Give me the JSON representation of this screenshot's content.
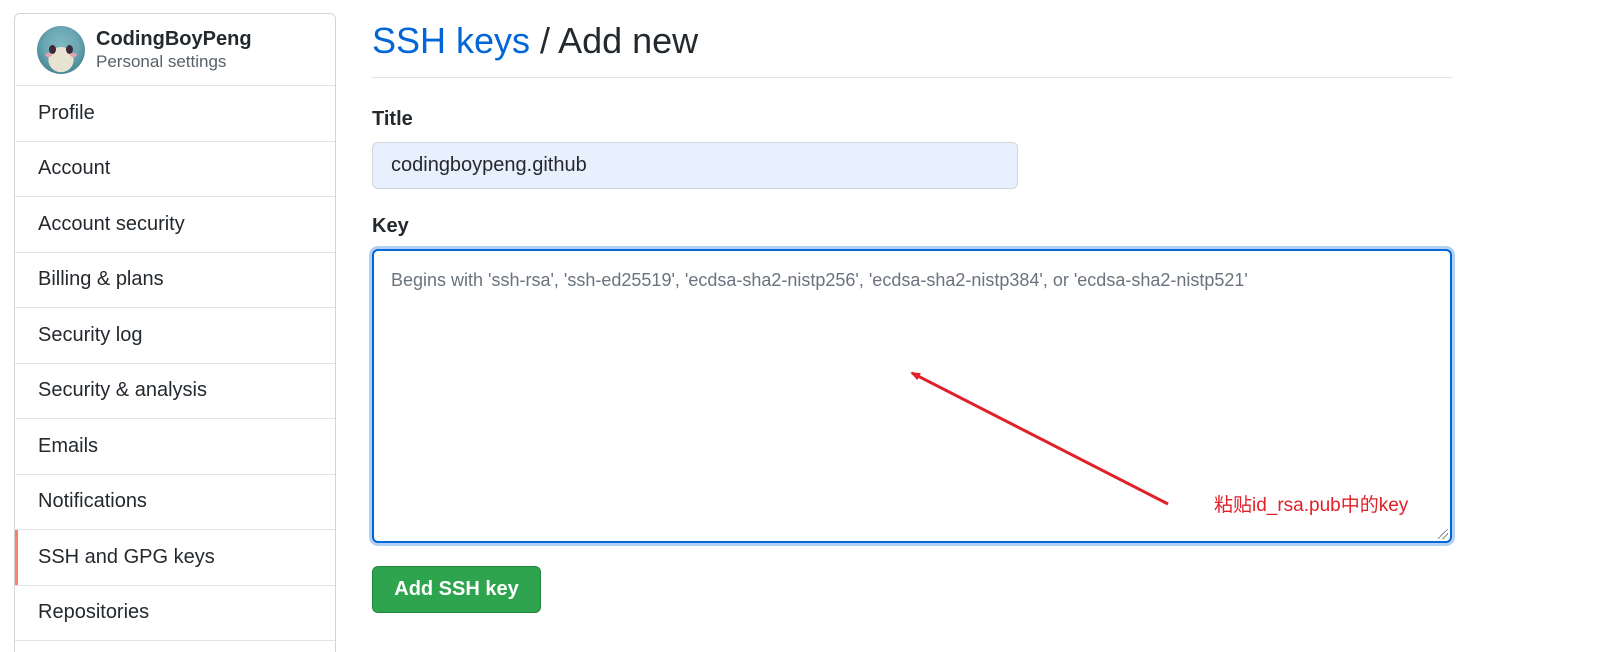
{
  "sidebar": {
    "user": {
      "name": "CodingBoyPeng",
      "subtitle": "Personal settings"
    },
    "items": [
      {
        "label": "Profile"
      },
      {
        "label": "Account"
      },
      {
        "label": "Account security"
      },
      {
        "label": "Billing & plans"
      },
      {
        "label": "Security log"
      },
      {
        "label": "Security & analysis"
      },
      {
        "label": "Emails"
      },
      {
        "label": "Notifications"
      },
      {
        "label": "SSH and GPG keys",
        "selected": true
      },
      {
        "label": "Repositories"
      }
    ]
  },
  "main": {
    "breadcrumb": {
      "link": "SSH keys",
      "separator": " / ",
      "current": "Add new"
    },
    "form": {
      "title_label": "Title",
      "title_value": "codingboypeng.github",
      "key_label": "Key",
      "key_placeholder": "Begins with 'ssh-rsa', 'ssh-ed25519', 'ecdsa-sha2-nistp256', 'ecdsa-sha2-nistp384', or 'ecdsa-sha2-nistp521'",
      "key_value": "",
      "submit_label": "Add SSH key"
    },
    "annotation": {
      "text": "粘贴id_rsa.pub中的key",
      "color": "#e0212a"
    }
  },
  "colors": {
    "link": "#0366d6",
    "button": "#2ea44f",
    "selected_marker": "#f9826c",
    "focus_border": "#0366d6"
  }
}
